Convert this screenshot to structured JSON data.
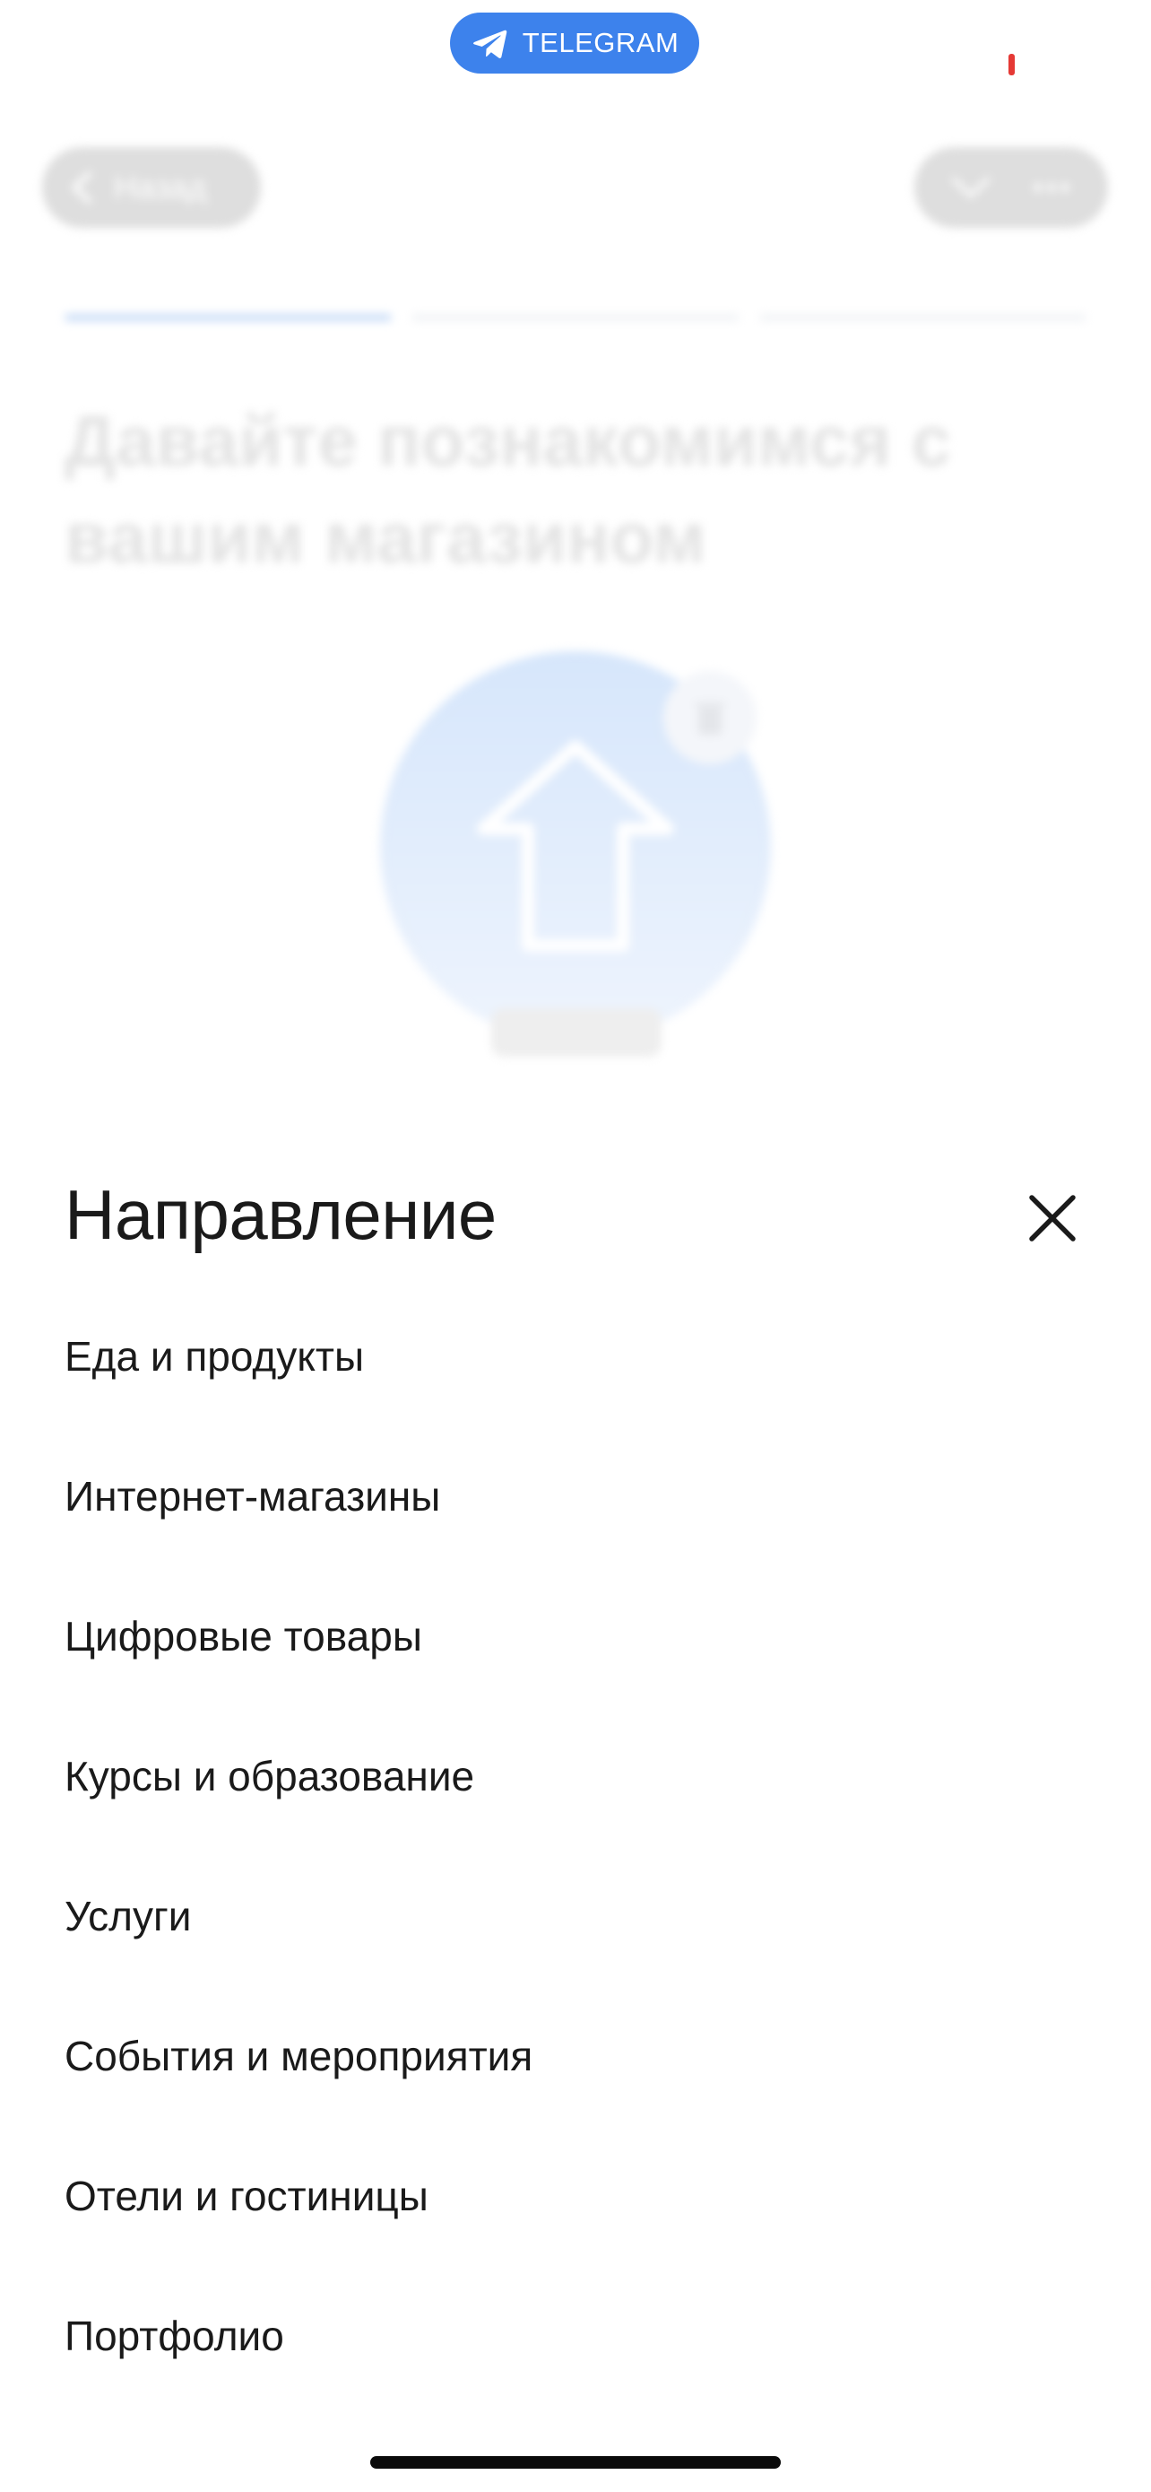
{
  "status_bar": {
    "telegram_label": "TELEGRAM",
    "recording_color": "#e53935"
  },
  "background": {
    "back_label": "Назад",
    "title": "Давайте познакомимся с вашим магазином",
    "progress_steps": 3,
    "active_step": 1,
    "accent": "#3d82ec"
  },
  "sheet": {
    "title": "Направление",
    "close_icon": "close-icon",
    "options": [
      "Еда и продукты",
      "Интернет-магазины",
      "Цифровые товары",
      "Курсы и образование",
      "Услуги",
      "События и мероприятия",
      "Отели и гостиницы",
      "Портфолио"
    ]
  }
}
